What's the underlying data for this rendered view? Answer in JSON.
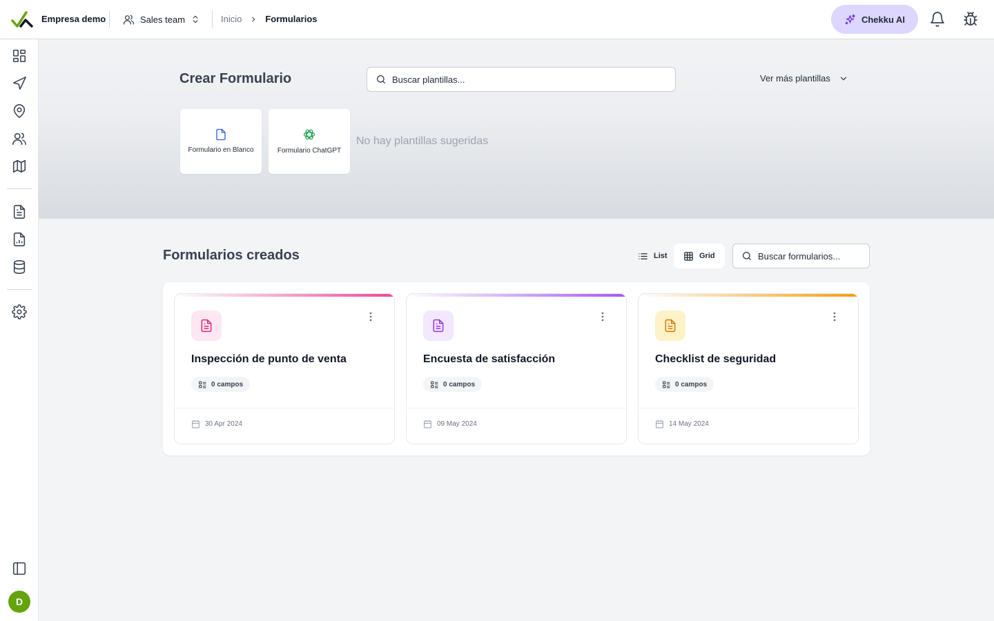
{
  "header": {
    "company": "Empresa demo",
    "team": "Sales team",
    "breadcrumb": [
      "Inicio",
      "Formularios"
    ],
    "ai_button": "Chekku AI"
  },
  "sidebar": {
    "icons": [
      "dashboard-icon",
      "send-icon",
      "location-pin-icon",
      "users-icon",
      "map-icon",
      "document-icon",
      "report-icon",
      "database-icon",
      "settings-icon",
      "panel-toggle-icon"
    ],
    "avatar_initial": "D"
  },
  "create": {
    "title": "Crear Formulario",
    "search_placeholder": "Buscar plantillas...",
    "more_templates": "Ver más plantillas",
    "blank_label": "Formulario en Blanco",
    "chatgpt_label": "Formulario ChatGPT",
    "no_templates": "No hay plantillas sugeridas"
  },
  "forms": {
    "title": "Formularios creados",
    "view_list": "List",
    "view_grid": "Grid",
    "active_view": "Grid",
    "search_placeholder": "Buscar formularios...",
    "items": [
      {
        "title": "Inspección de punto de venta",
        "fields": "0 campos",
        "date": "30 Apr 2024",
        "accent": "#ec4899",
        "icon_bg": "#fce7f3",
        "icon_color": "#db2777"
      },
      {
        "title": "Encuesta de satisfacción",
        "fields": "0 campos",
        "date": "09 May 2024",
        "accent": "#a855f7",
        "icon_bg": "#f3e8ff",
        "icon_color": "#9333ea"
      },
      {
        "title": "Checklist de seguridad",
        "fields": "0 campos",
        "date": "14 May 2024",
        "accent": "#f59e0b",
        "icon_bg": "#fef3c7",
        "icon_color": "#d97706"
      }
    ]
  },
  "colors": {
    "brand_green": "#65a30d",
    "ai_button_bg": "#ddd6fe"
  }
}
